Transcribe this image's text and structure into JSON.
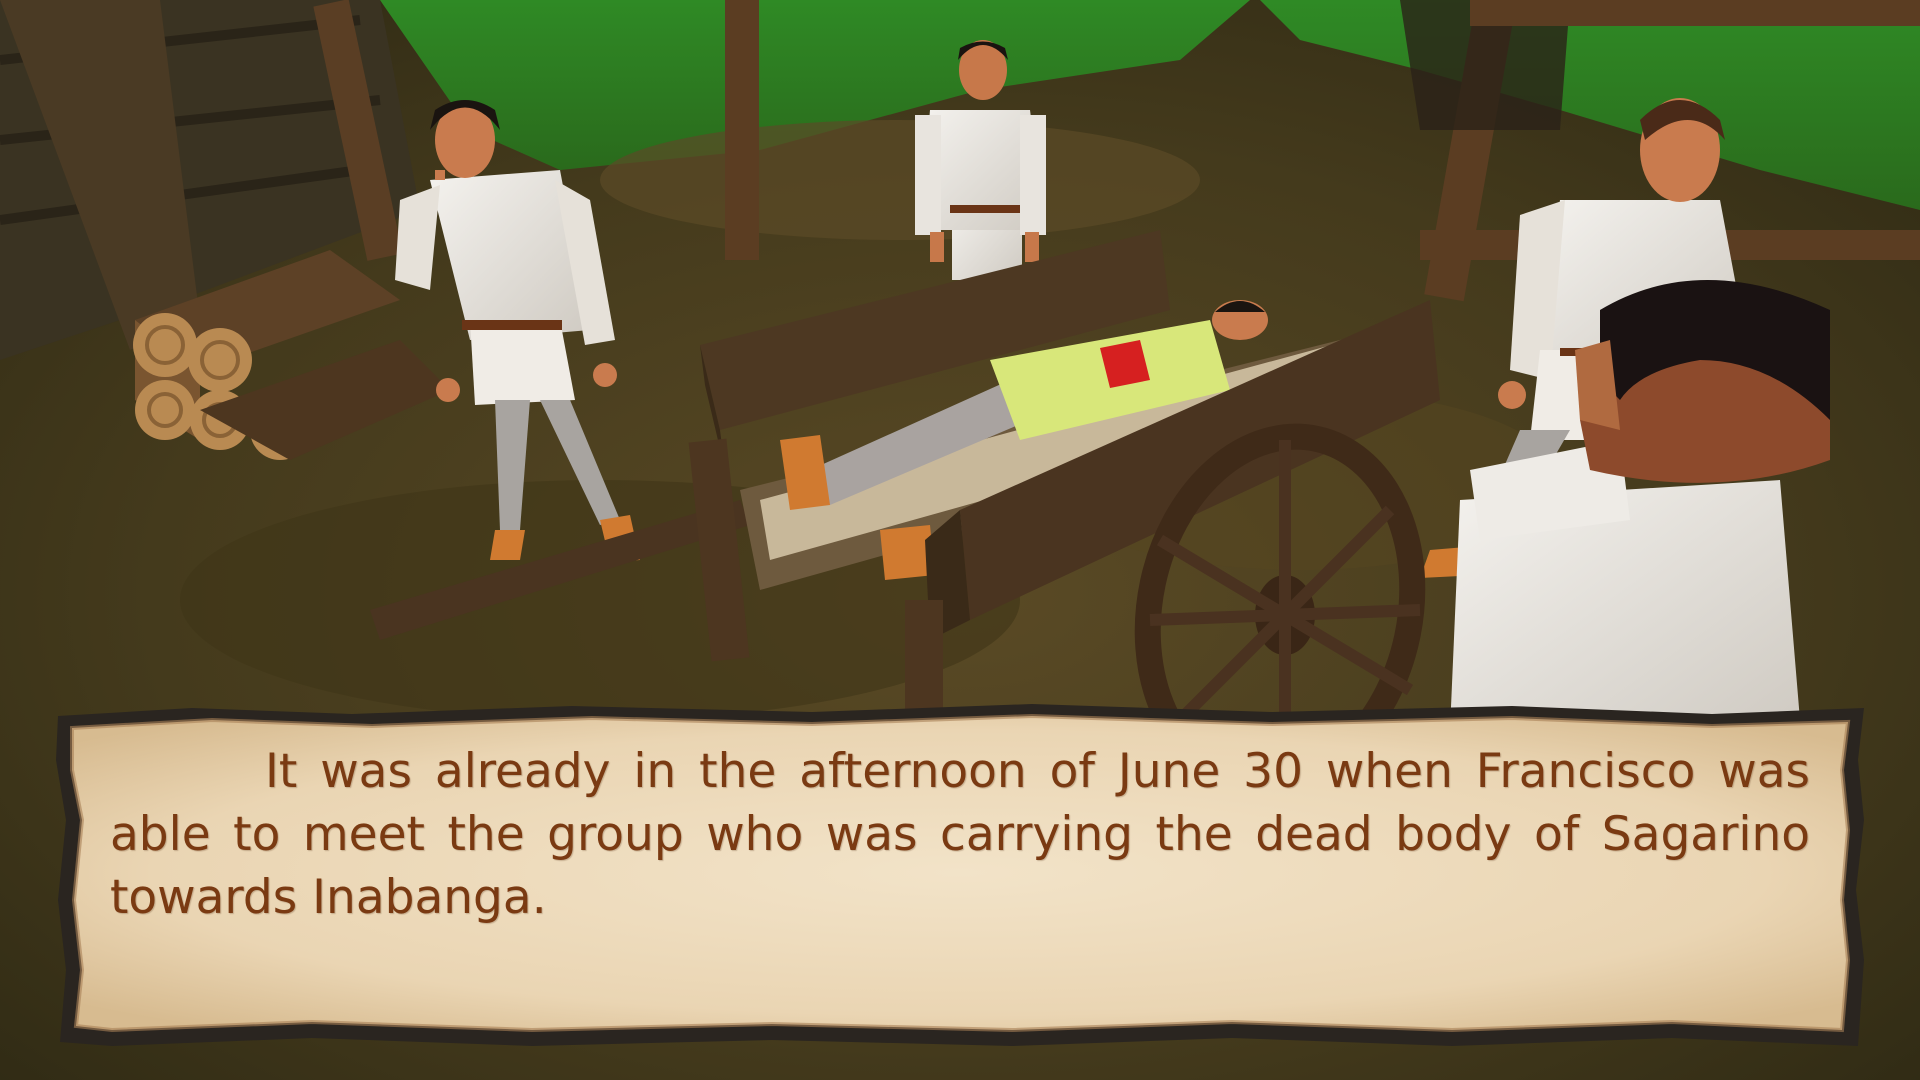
{
  "dialog": {
    "text": "It was already in the afternoon of June 30 when Francisco was able to meet the group who was carrying the dead body of Sagarino towards Inabanga."
  },
  "colors": {
    "grass": "#2f7a23",
    "ground": "#4a3f1e",
    "wood": "#4a3420",
    "parchment": "#efdcc0",
    "dialog_text": "#7a3a12",
    "frame": "#2a2520"
  },
  "scene": {
    "characters": [
      "villager-left",
      "villager-back",
      "villager-right",
      "villager-foreground",
      "body-on-cart"
    ],
    "props": [
      "log-pile",
      "wooden-cart",
      "cart-wheel",
      "hut-wall",
      "wooden-posts"
    ]
  }
}
